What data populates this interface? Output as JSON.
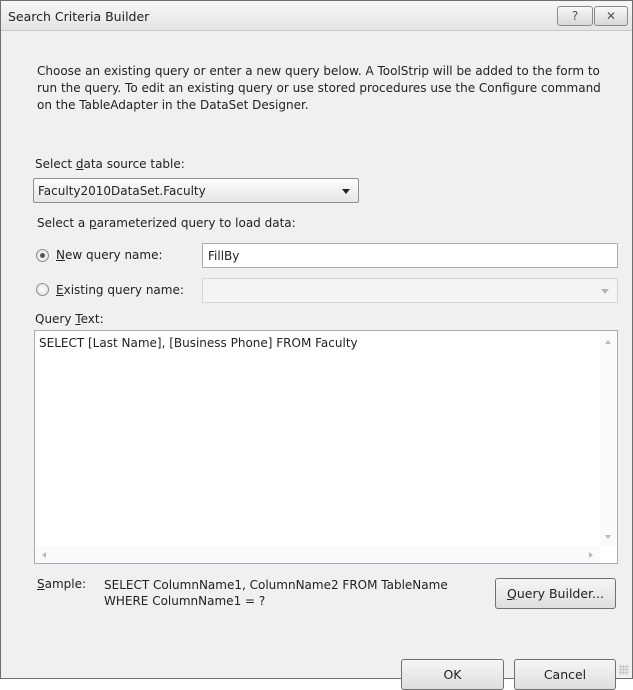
{
  "window": {
    "title": "Search Criteria Builder",
    "help_glyph": "?",
    "close_glyph": "✕"
  },
  "intro_text": "Choose an existing query or enter a new query below. A ToolStrip will be added to the form to run the query. To edit an existing query or use stored procedures use the Configure command on the TableAdapter in the DataSet Designer.",
  "data_source": {
    "label_pre": "Select ",
    "label_accel": "d",
    "label_post": "ata source table:",
    "selected": "Faculty2010DataSet.Faculty"
  },
  "param_query": {
    "label_pre": "Select a ",
    "label_accel": "p",
    "label_post": "arameterized query to load data:"
  },
  "new_query": {
    "label_accel": "N",
    "label_post": "ew query name:",
    "value": "FillBy",
    "selected": true
  },
  "existing_query": {
    "label_accel": "E",
    "label_post": "xisting query name:",
    "value": "",
    "selected": false
  },
  "query_text": {
    "label_pre": "Query ",
    "label_accel": "T",
    "label_post": "ext:",
    "value": "SELECT [Last Name], [Business Phone] FROM Faculty"
  },
  "sample": {
    "label_accel": "S",
    "label_post": "ample:",
    "line1": "SELECT ColumnName1, ColumnName2 FROM TableName",
    "line2": "WHERE ColumnName1 = ?"
  },
  "buttons": {
    "query_builder_accel": "Q",
    "query_builder_post": "uery Builder...",
    "ok": "OK",
    "cancel": "Cancel"
  }
}
